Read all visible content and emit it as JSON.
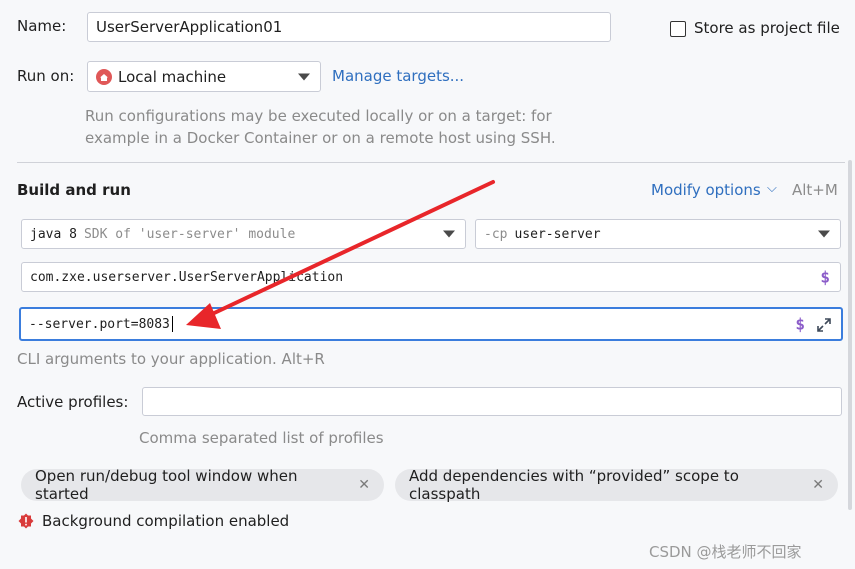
{
  "name": {
    "label": "Name:",
    "value": "UserServerApplication01"
  },
  "store": {
    "label": "Store as project file"
  },
  "run_on": {
    "label": "Run on:",
    "value": "Local machine",
    "manage_link": "Manage targets...",
    "description_line1": "Run configurations may be executed locally or on a target: for",
    "description_line2": "example in a Docker Container or on a remote host using SSH."
  },
  "build_run": {
    "title": "Build and run",
    "modify_options": "Modify options",
    "modify_shortcut": "Alt+M",
    "sdk_prefix": "java 8",
    "sdk_suffix": "SDK of 'user-server' module",
    "cp_prefix": "-cp",
    "cp_value": "user-server",
    "main_class": "com.zxe.userserver.UserServerApplication",
    "program_args": "--server.port=8083",
    "args_hint": "CLI arguments to your application. Alt+R"
  },
  "profiles": {
    "label": "Active profiles:",
    "value": "",
    "hint": "Comma separated list of profiles"
  },
  "chips": [
    {
      "label": "Open run/debug tool window when started"
    },
    {
      "label": "Add dependencies with “provided” scope to classpath"
    }
  ],
  "status": {
    "text": "Background compilation enabled"
  },
  "watermark": "CSDN @栈老师不回家",
  "colors": {
    "accent": "#2f6fbf",
    "arrow": "#e8262a",
    "focus": "#3b7ddd",
    "warning": "#d93b3b"
  }
}
